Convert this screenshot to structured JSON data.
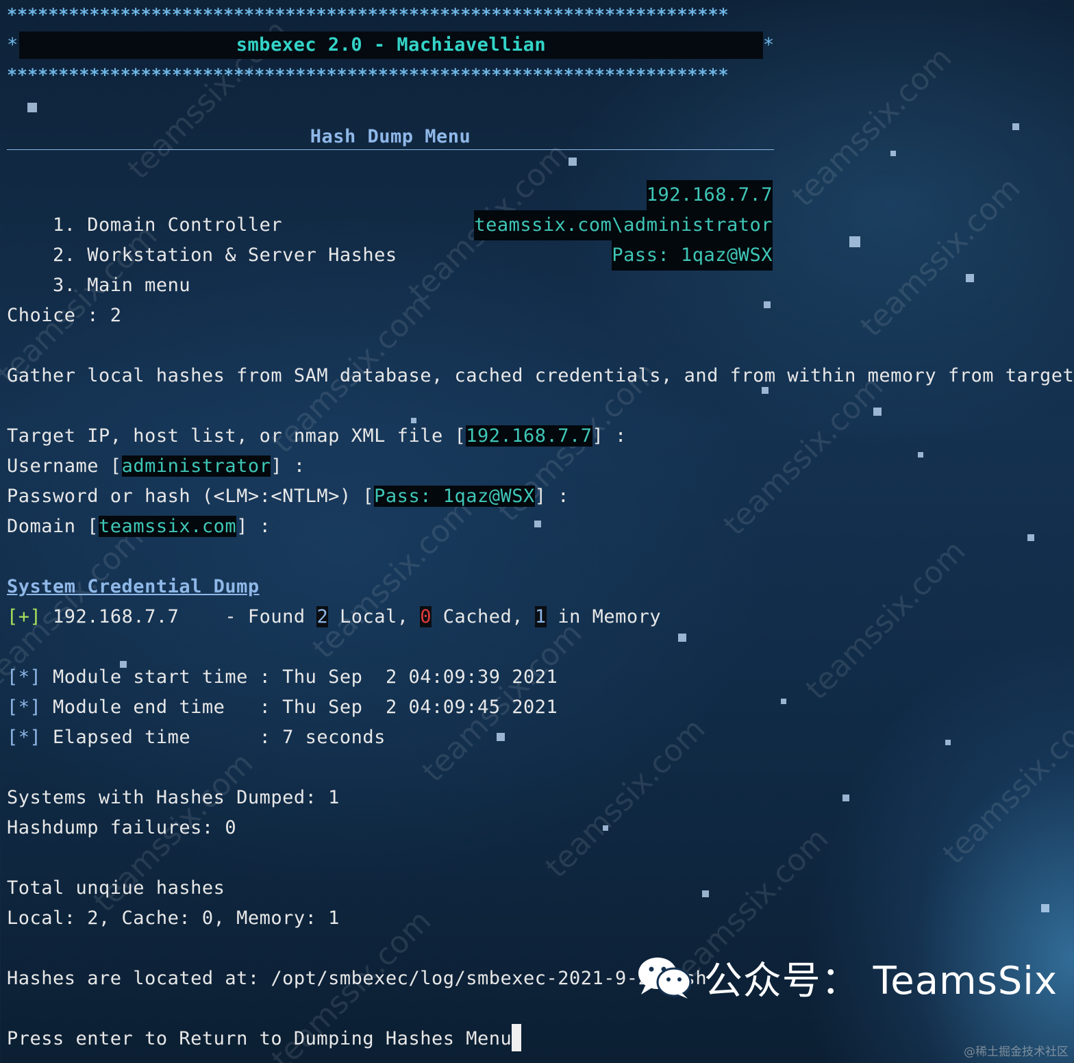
{
  "banner": {
    "stars": "**********************************************************************",
    "edge": "*",
    "title": "smbexec 2.0 - Machiavellian"
  },
  "menu": {
    "title": "Hash Dump Menu",
    "items": [
      {
        "label": "1. Domain Controller",
        "value": "192.168.7.7"
      },
      {
        "label": "2. Workstation & Server Hashes",
        "value": "teamssix.com\\administrator"
      },
      {
        "label": "3. Main menu",
        "value": "Pass: 1qaz@WSX"
      }
    ]
  },
  "choice": "Choice : 2",
  "description": "Gather local hashes from SAM database, cached credentials, and from within memory from targets.",
  "prompts": {
    "target": {
      "label": "Target IP, host list, or nmap XML file [",
      "value": "192.168.7.7",
      "end": "] :"
    },
    "username": {
      "label": "Username [",
      "value": "administrator",
      "end": "] :"
    },
    "password": {
      "label": "Password or hash (<LM>:<NTLM>) [",
      "value": "Pass: 1qaz@WSX",
      "end": "] :"
    },
    "domain": {
      "label": "Domain [",
      "value": "teamssix.com",
      "end": "] :"
    }
  },
  "dump": {
    "title": "System Credential Dump",
    "marker": "[+]",
    "ip": " 192.168.7.7",
    "found": "    - Found ",
    "local_count": "2",
    "local_label": " Local, ",
    "cached_count": "0",
    "cached_label": " Cached, ",
    "memory_count": "1",
    "memory_label": " in Memory"
  },
  "timing": [
    {
      "marker": "[*]",
      "text": " Module start time : Thu Sep  2 04:09:39 2021"
    },
    {
      "marker": "[*]",
      "text": " Module end time   : Thu Sep  2 04:09:45 2021"
    },
    {
      "marker": "[*]",
      "text": " Elapsed time      : 7 seconds"
    }
  ],
  "summary": {
    "systems": "Systems with Hashes Dumped: 1",
    "failures": "Hashdump failures: 0",
    "total_title": "Total unqiue hashes",
    "totals": "Local: 2, Cache: 0, Memory: 1",
    "location": "Hashes are located at: /opt/smbexec/log/smbexec-2021-9-2/hash"
  },
  "prompt_return": "Press enter to Return to Dumping Hashes Menu",
  "watermark": "teamssix.com",
  "brand": {
    "icon": "wechat-icon",
    "text": "公众号： TeamsSix"
  },
  "credit": "@稀土掘金技术社区",
  "colors": {
    "cyan": "#3fc7b7",
    "accent_blue": "#8fb8e8",
    "green": "#a8e05c",
    "red": "#e23b3b",
    "background": "#143150"
  }
}
